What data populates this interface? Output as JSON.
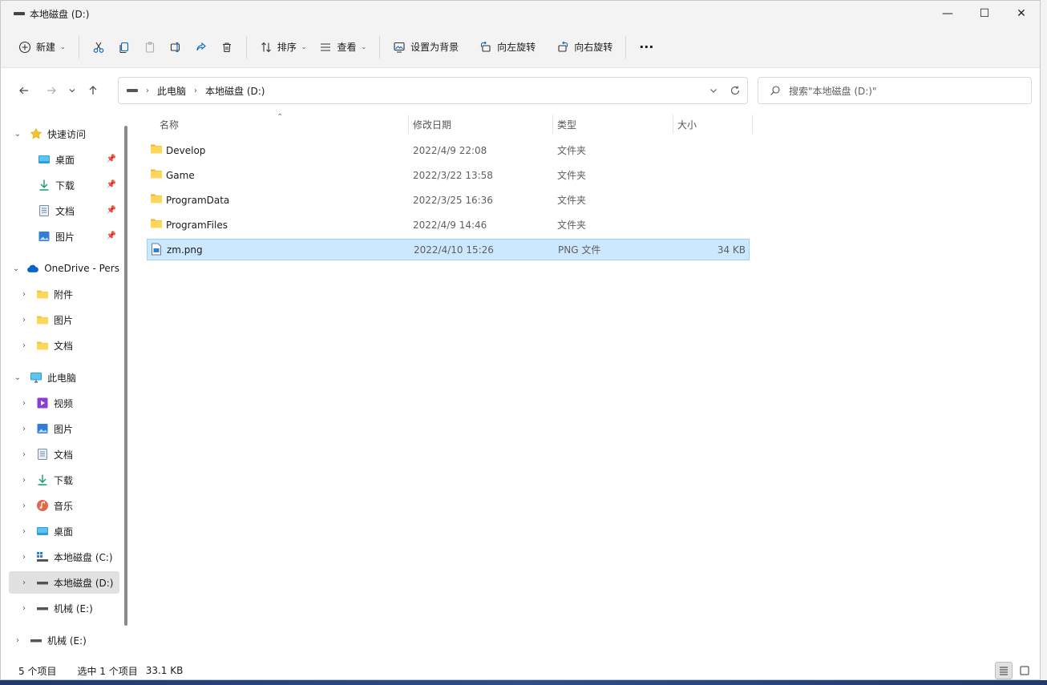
{
  "window": {
    "title": "本地磁盘 (D:)",
    "controls": {
      "minimize": "—",
      "maximize": "☐",
      "close": "✕"
    }
  },
  "toolbar": {
    "new_label": "新建",
    "sort_label": "排序",
    "view_label": "查看",
    "set_background_label": "设置为背景",
    "rotate_left_label": "向左旋转",
    "rotate_right_label": "向右旋转",
    "more_label": "···"
  },
  "address": {
    "crumbs": [
      "此电脑",
      "本地磁盘 (D:)"
    ],
    "search_placeholder": "搜索\"本地磁盘 (D:)\""
  },
  "sidebar": {
    "quick_access": "快速访问",
    "quick_items": [
      "桌面",
      "下载",
      "文档",
      "图片"
    ],
    "onedrive": "OneDrive - Pers",
    "onedrive_items": [
      "附件",
      "图片",
      "文档"
    ],
    "this_pc": "此电脑",
    "pc_items": [
      "视频",
      "图片",
      "文档",
      "下载",
      "音乐",
      "桌面",
      "本地磁盘 (C:)",
      "本地磁盘 (D:)",
      "机械 (E:)"
    ],
    "mech_drive": "机械 (E:)"
  },
  "columns": {
    "name": "名称",
    "modified": "修改日期",
    "type": "类型",
    "size": "大小"
  },
  "files": [
    {
      "name": "Develop",
      "date": "2022/4/9 22:08",
      "type": "文件夹",
      "size": ""
    },
    {
      "name": "Game",
      "date": "2022/3/22 13:58",
      "type": "文件夹",
      "size": ""
    },
    {
      "name": "ProgramData",
      "date": "2022/3/25 16:36",
      "type": "文件夹",
      "size": ""
    },
    {
      "name": "ProgramFiles",
      "date": "2022/4/9 14:46",
      "type": "文件夹",
      "size": ""
    },
    {
      "name": "zm.png",
      "date": "2022/4/10 15:26",
      "type": "PNG 文件",
      "size": "34 KB"
    }
  ],
  "status": {
    "count": "5 个项目",
    "selected": "选中 1 个项目",
    "selected_size": "33.1 KB"
  },
  "colors": {
    "accent": "#0067c0",
    "folder": "#f5c446",
    "selection": "#cce8ff"
  }
}
